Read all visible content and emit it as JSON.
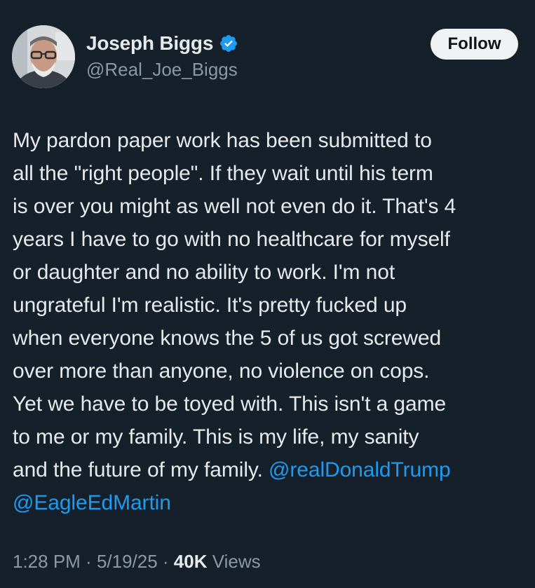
{
  "author": {
    "name": "Joseph Biggs",
    "handle": "@Real_Joe_Biggs",
    "verified": true
  },
  "follow_label": "Follow",
  "tweet": {
    "text": "My pardon paper work has been submitted to\nall the \"right people\". If they wait until his term\nis over you might as well not even do it. That's 4\nyears I have to go with no healthcare for myself\nor daughter and no ability to work. I'm not\nungrateful I'm realistic. It's pretty fucked up\nwhen everyone knows the 5 of us got screwed\nover more than anyone, no violence on cops.\nYet we have to be toyed with. This isn't a game\nto me or my family. This is my life, my sanity\nand the future of my family. ",
    "mentions": [
      "@realDonaldTrump",
      "@EagleEdMartin"
    ]
  },
  "meta": {
    "time": "1:28 PM",
    "separator": " · ",
    "date": "5/19/25",
    "views_count": "40K",
    "views_label": " Views"
  },
  "colors": {
    "background": "#15202b",
    "mention": "#1d9bf0",
    "verified": "#1d9bf0",
    "secondary_text": "#8b98a5"
  },
  "icons": {
    "verified": "verified-badge-icon",
    "avatar": "profile-photo"
  }
}
